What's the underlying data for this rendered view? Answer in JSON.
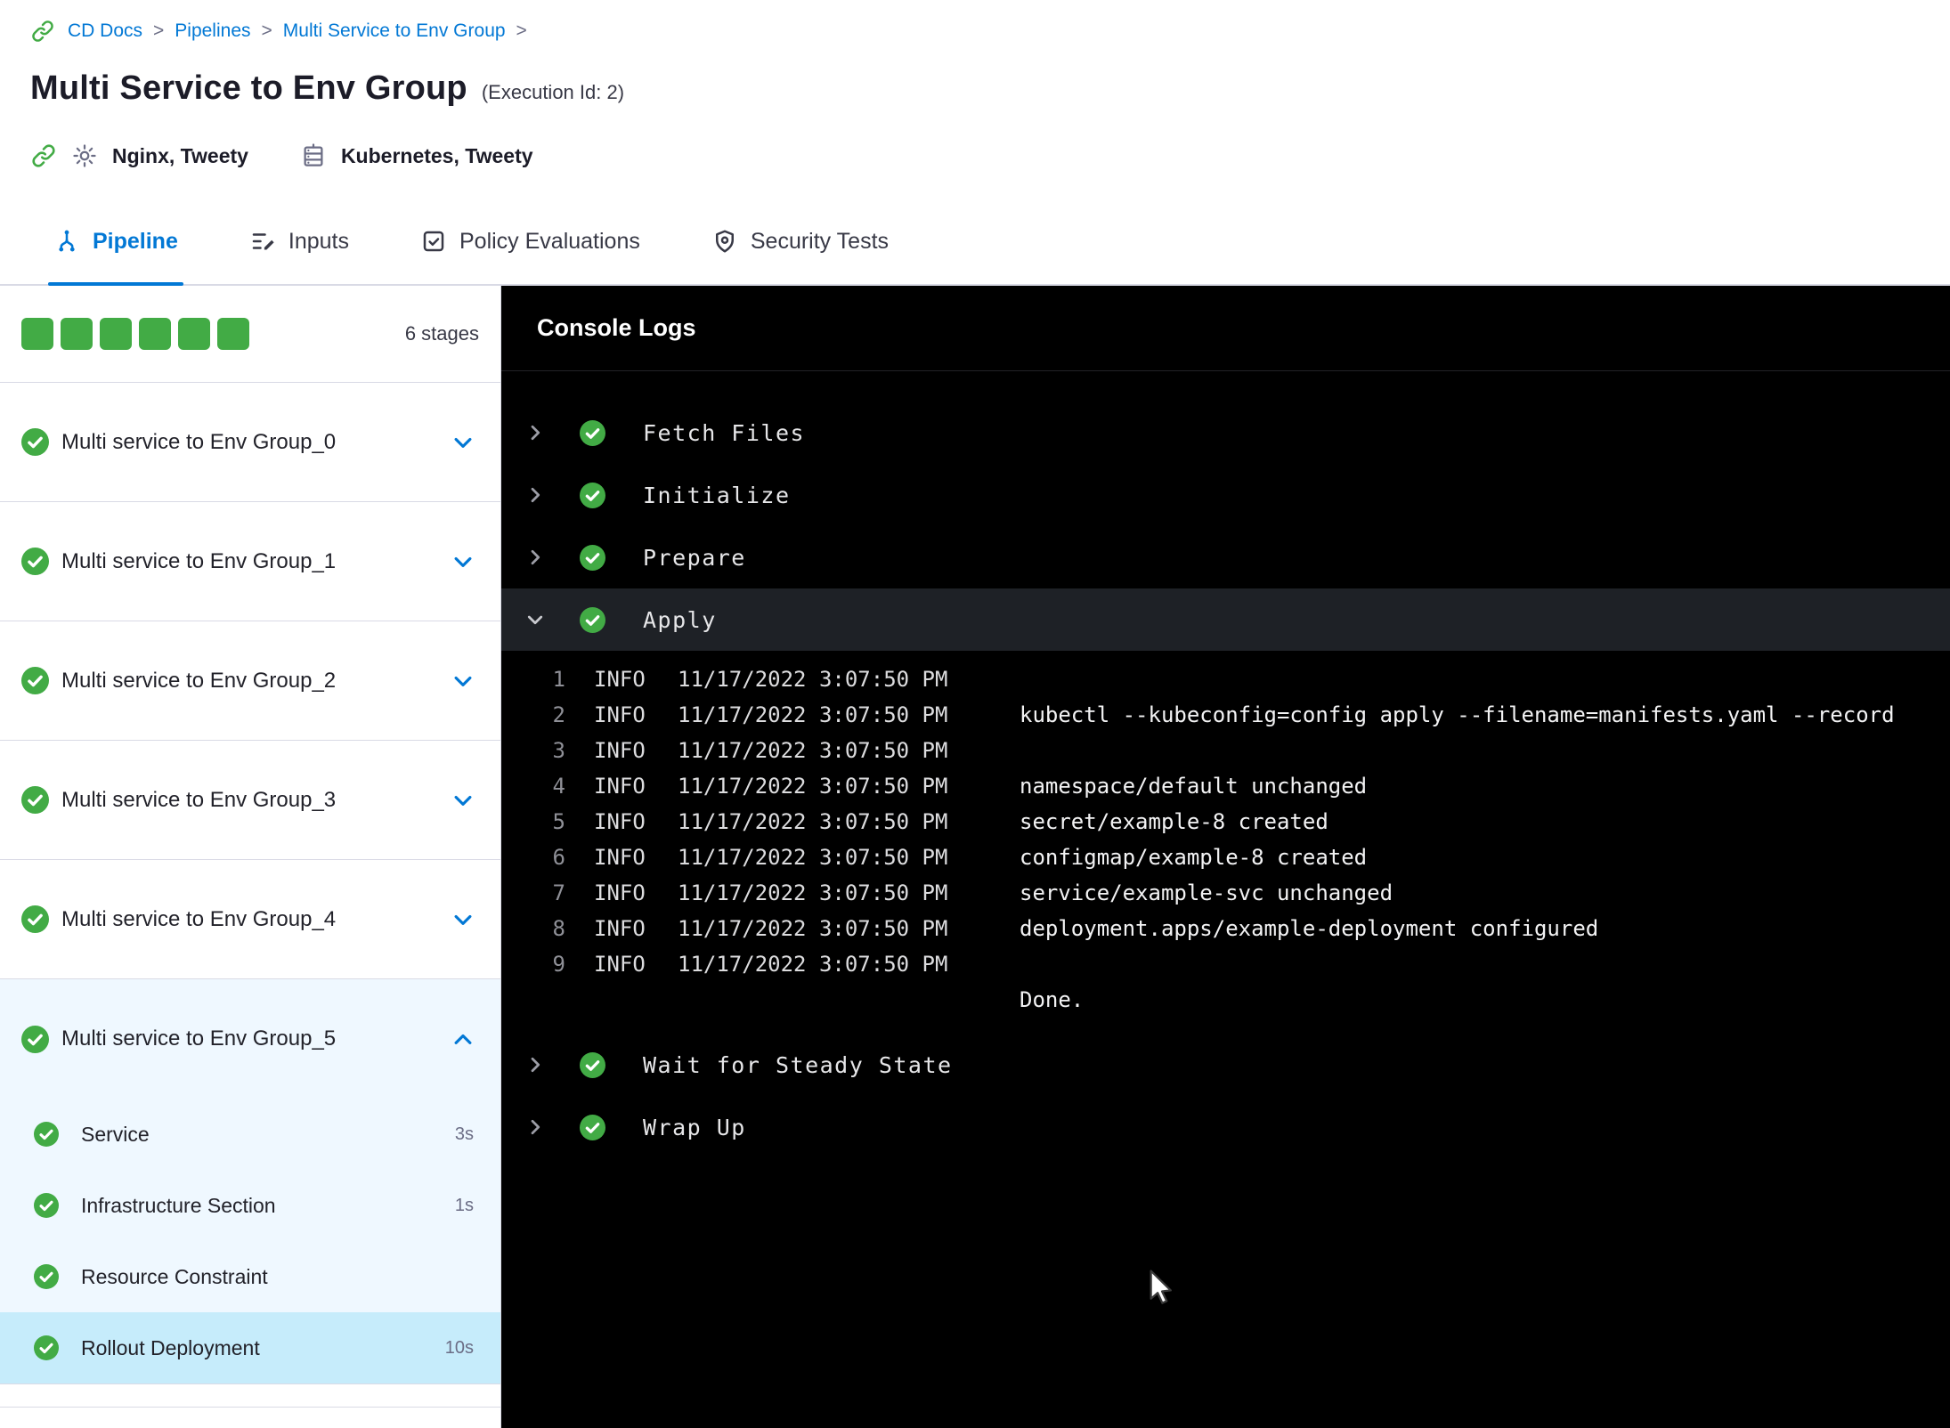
{
  "colors": {
    "accent": "#0278D5",
    "green": "#42AB45",
    "console-bg": "#000000",
    "selected-bg": "#C6ECFB",
    "expanded-bg": "#EFF8FF"
  },
  "breadcrumb": {
    "separator": ">",
    "items": [
      "CD Docs",
      "Pipelines",
      "Multi Service to Env Group"
    ]
  },
  "header": {
    "title": "Multi Service to Env Group",
    "execution_id": "(Execution Id: 2)",
    "services": "Nginx, Tweety",
    "environments": "Kubernetes, Tweety"
  },
  "tabs": [
    {
      "label": "Pipeline",
      "icon": "pipeline",
      "active": true
    },
    {
      "label": "Inputs",
      "icon": "inputs",
      "active": false
    },
    {
      "label": "Policy Evaluations",
      "icon": "policy",
      "active": false
    },
    {
      "label": "Security Tests",
      "icon": "security",
      "active": false
    }
  ],
  "sidebar": {
    "progress_squares": 6,
    "stages_count_label": "6 stages",
    "stages": [
      {
        "label": "Multi service to Env Group_0",
        "status": "success",
        "expanded": false
      },
      {
        "label": "Multi service to Env Group_1",
        "status": "success",
        "expanded": false
      },
      {
        "label": "Multi service to Env Group_2",
        "status": "success",
        "expanded": false
      },
      {
        "label": "Multi service to Env Group_3",
        "status": "success",
        "expanded": false
      },
      {
        "label": "Multi service to Env Group_4",
        "status": "success",
        "expanded": false
      },
      {
        "label": "Multi service to Env Group_5",
        "status": "success",
        "expanded": true,
        "steps": [
          {
            "label": "Service",
            "duration": "3s",
            "selected": false
          },
          {
            "label": "Infrastructure Section",
            "duration": "1s",
            "selected": false
          },
          {
            "label": "Resource Constraint",
            "duration": "",
            "selected": false
          },
          {
            "label": "Rollout Deployment",
            "duration": "10s",
            "selected": true
          }
        ]
      }
    ]
  },
  "console": {
    "title": "Console Logs",
    "steps": [
      {
        "label": "Fetch Files",
        "status": "success",
        "expanded": false
      },
      {
        "label": "Initialize",
        "status": "success",
        "expanded": false
      },
      {
        "label": "Prepare",
        "status": "success",
        "expanded": false
      },
      {
        "label": "Apply",
        "status": "success",
        "expanded": true,
        "logs": [
          {
            "num": "1",
            "level": "INFO",
            "time": "11/17/2022 3:07:50 PM",
            "msg": ""
          },
          {
            "num": "2",
            "level": "INFO",
            "time": "11/17/2022 3:07:50 PM",
            "msg": "kubectl --kubeconfig=config apply --filename=manifests.yaml --record"
          },
          {
            "num": "3",
            "level": "INFO",
            "time": "11/17/2022 3:07:50 PM",
            "msg": ""
          },
          {
            "num": "4",
            "level": "INFO",
            "time": "11/17/2022 3:07:50 PM",
            "msg": "namespace/default unchanged"
          },
          {
            "num": "5",
            "level": "INFO",
            "time": "11/17/2022 3:07:50 PM",
            "msg": "secret/example-8 created"
          },
          {
            "num": "6",
            "level": "INFO",
            "time": "11/17/2022 3:07:50 PM",
            "msg": "configmap/example-8 created"
          },
          {
            "num": "7",
            "level": "INFO",
            "time": "11/17/2022 3:07:50 PM",
            "msg": "service/example-svc unchanged"
          },
          {
            "num": "8",
            "level": "INFO",
            "time": "11/17/2022 3:07:50 PM",
            "msg": "deployment.apps/example-deployment configured"
          },
          {
            "num": "9",
            "level": "INFO",
            "time": "11/17/2022 3:07:50 PM",
            "msg": ""
          },
          {
            "num": "",
            "level": "",
            "time": "",
            "msg": "Done."
          }
        ]
      },
      {
        "label": "Wait for Steady State",
        "status": "success",
        "expanded": false
      },
      {
        "label": "Wrap Up",
        "status": "success",
        "expanded": false
      }
    ]
  }
}
